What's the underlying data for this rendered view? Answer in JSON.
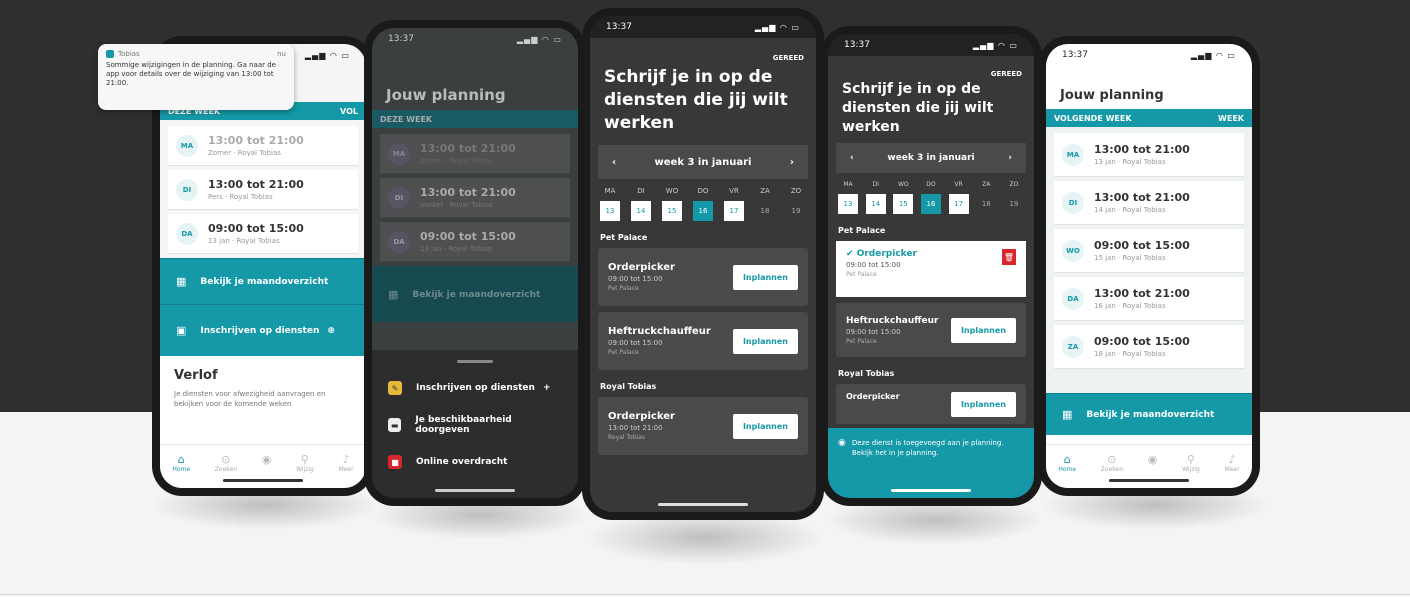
{
  "colors": {
    "accent": "#1599a8",
    "dark": "#2f2f2f",
    "danger": "#d9262c"
  },
  "phone1": {
    "status_time": "",
    "status_icons": "▂▄▆ ◠ ▭",
    "notification": {
      "app": "Tobias",
      "time": "nu",
      "text": "Sommige wijzigingen in de planning. Ga naar de app voor details over de wijziging van 13:00 tot 21:00."
    },
    "weekbar_left": "DEZE WEEK",
    "weekbar_right": "VOL",
    "shifts": [
      {
        "day": "MA",
        "time": "13:00 tot 21:00",
        "sub": "Zomer · Royal Tobias"
      },
      {
        "day": "DI",
        "time": "13:00 tot 21:00",
        "sub": "Pers · Royal Tobias"
      },
      {
        "day": "DA",
        "time": "09:00 tot 15:00",
        "sub": "13 jan · Royal Tobias"
      }
    ],
    "btn_overview": "Bekijk je maandoverzicht",
    "btn_signup": "Inschrijven op diensten",
    "leave_title": "Verlof",
    "leave_text": "Je diensten voor afwezigheid aanvragen en bekijken voor de komende weken",
    "tabs": [
      "Home",
      "Zoeken",
      "",
      "Wijzig",
      "Meer"
    ]
  },
  "phone2": {
    "status_time": "13:37",
    "status_icons": "▂▄▆ ◠ ▭",
    "title": "Jouw planning",
    "weekbar_left": "DEZE WEEK",
    "shifts": [
      {
        "day": "MA",
        "time": "13:00 tot 21:00",
        "sub": "Zomer · Royal Tobias"
      },
      {
        "day": "DI",
        "time": "13:00 tot 21:00",
        "sub": "Vonkel · Royal Tobias"
      },
      {
        "day": "DA",
        "time": "09:00 tot 15:00",
        "sub": "13 jan · Royal Tobias"
      }
    ],
    "btn_overview": "Bekijk je maandoverzicht",
    "menu": [
      {
        "label": "Inschrijven op diensten",
        "badge": "+"
      },
      {
        "label": "Je beschikbaarheid doorgeven",
        "badge": ""
      },
      {
        "label": "Online overdracht",
        "badge": ""
      }
    ]
  },
  "phone3": {
    "status_time": "13:37",
    "status_icons": "▂▄▆ ◠ ▭",
    "done": "GEREED",
    "title": "Schrijf je in op de diensten die jij wilt werken",
    "week_label": "week 3 in januari",
    "days": [
      "MA",
      "DI",
      "WO",
      "DO",
      "VR",
      "ZA",
      "ZO"
    ],
    "dates": [
      "13",
      "14",
      "15",
      "16",
      "17",
      "18",
      "19"
    ],
    "sections": [
      {
        "name": "Pet Palace",
        "cards": [
          {
            "title": "Orderpicker",
            "time": "09:00 tot 15:00",
            "loc": "Pet Palace",
            "btn": "Inplannen"
          },
          {
            "title": "Heftruckchauffeur",
            "time": "09:00 tot 15:00",
            "loc": "Pet Palace",
            "btn": "Inplannen"
          }
        ]
      },
      {
        "name": "Royal Tobias",
        "cards": [
          {
            "title": "Orderpicker",
            "time": "13:00 tot 21:00",
            "loc": "Royal Tobias",
            "btn": "Inplannen"
          }
        ]
      }
    ]
  },
  "phone4": {
    "status_time": "13:37",
    "status_icons": "▂▄▆ ◠ ▭",
    "done": "GEREED",
    "title": "Schrijf je in op de diensten die jij wilt werken",
    "week_label": "week 3 in januari",
    "days": [
      "MA",
      "DI",
      "WO",
      "DO",
      "VR",
      "ZA",
      "ZO"
    ],
    "dates": [
      "13",
      "14",
      "15",
      "16",
      "17",
      "18",
      "19"
    ],
    "section1": "Pet Palace",
    "selected": {
      "title": "Orderpicker",
      "time": "09:00 tot 15:00",
      "loc": "Pet Palace"
    },
    "card2": {
      "title": "Heftruckchauffeur",
      "time": "09:00 tot 15:00",
      "loc": "Pet Palace",
      "btn": "Inplannen"
    },
    "section2": "Royal Tobias",
    "card3": {
      "title": "Orderpicker",
      "btn": "Inplannen"
    },
    "toast": "Deze dienst is toegevoegd aan je planning. Bekijk het in je planning."
  },
  "phone5": {
    "status_time": "13:37",
    "status_icons": "▂▄▆ ◠ ▭",
    "title": "Jouw planning",
    "weekbar_left": "VOLGENDE WEEK",
    "weekbar_right": "WEEK",
    "shifts": [
      {
        "day": "MA",
        "time": "13:00 tot 21:00",
        "sub": "13 jan · Royal Tobias"
      },
      {
        "day": "DI",
        "time": "13:00 tot 21:00",
        "sub": "14 jan · Royal Tobias"
      },
      {
        "day": "WO",
        "time": "09:00 tot 15:00",
        "sub": "15 jan · Royal Tobias"
      },
      {
        "day": "DA",
        "time": "13:00 tot 21:00",
        "sub": "16 jan · Royal Tobias"
      },
      {
        "day": "ZA",
        "time": "09:00 tot 15:00",
        "sub": "18 jan · Royal Tobias"
      }
    ],
    "btn_overview": "Bekijk je maandoverzicht",
    "tabs": [
      "Home",
      "Zoeken",
      "",
      "Wijzig",
      "Meer"
    ]
  }
}
